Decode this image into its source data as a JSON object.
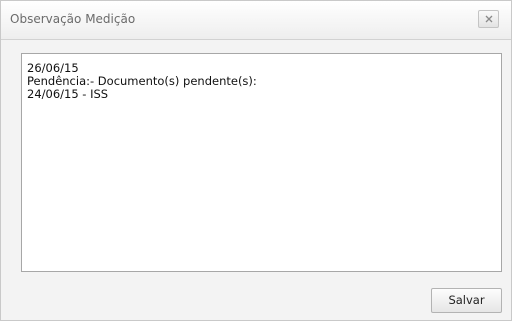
{
  "dialog": {
    "title": "Observação Medição",
    "close_icon": "close-icon"
  },
  "observation": {
    "lines": [
      "26/06/15",
      "Pendência:- Documento(s) pendente(s):",
      "24/06/15 - ISS"
    ]
  },
  "footer": {
    "save_label": "Salvar"
  }
}
